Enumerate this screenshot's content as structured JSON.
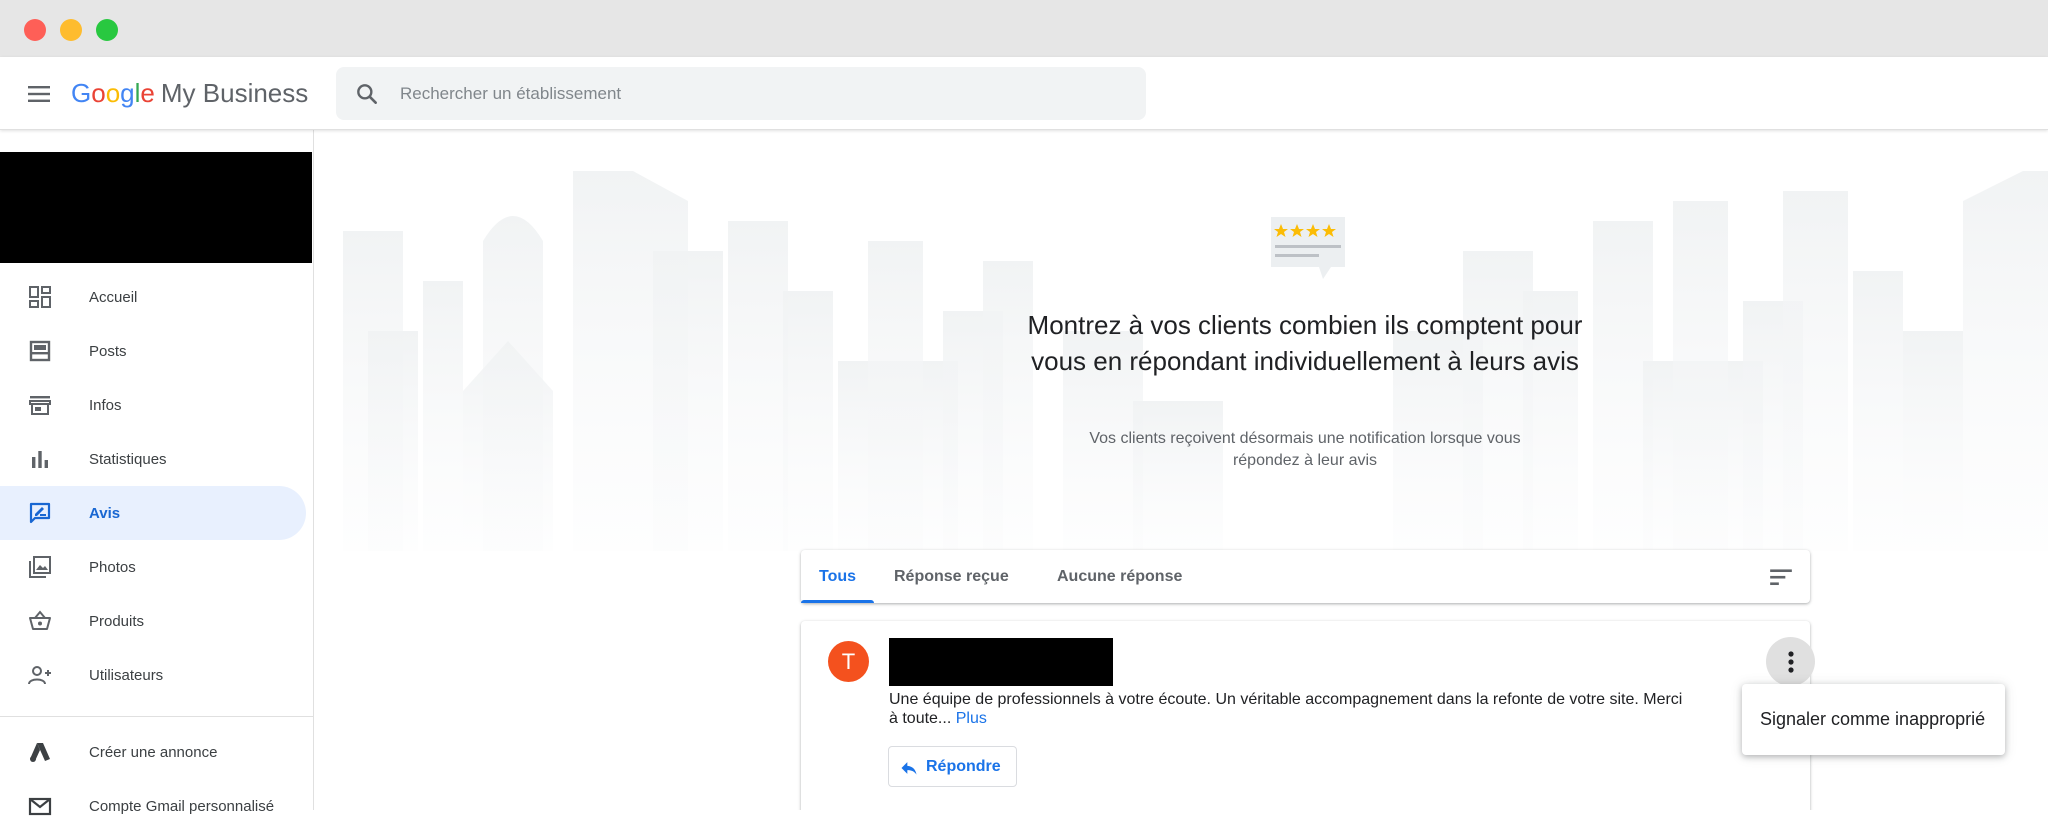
{
  "header": {
    "logo": {
      "g1": "G",
      "o1": "o",
      "o2": "o",
      "g2": "g",
      "l": "l",
      "e": "e",
      "product": "My Business"
    },
    "search": {
      "placeholder": "Rechercher un établissement",
      "value": ""
    }
  },
  "sidebar": {
    "items": [
      {
        "label": "Accueil",
        "icon": "dashboard-icon",
        "active": false
      },
      {
        "label": "Posts",
        "icon": "posts-icon",
        "active": false
      },
      {
        "label": "Infos",
        "icon": "storefront-icon",
        "active": false
      },
      {
        "label": "Statistiques",
        "icon": "bar-chart-icon",
        "active": false
      },
      {
        "label": "Avis",
        "icon": "rate-review-icon",
        "active": true
      },
      {
        "label": "Photos",
        "icon": "photo-library-icon",
        "active": false
      },
      {
        "label": "Produits",
        "icon": "shopping-basket-icon",
        "active": false
      },
      {
        "label": "Utilisateurs",
        "icon": "person-add-icon",
        "active": false
      }
    ],
    "extra_items": [
      {
        "label": "Créer une annonce",
        "icon": "google-ads-icon"
      },
      {
        "label": "Compte Gmail personnalisé",
        "icon": "gmail-icon"
      }
    ]
  },
  "hero": {
    "title": "Montrez à vos clients combien ils comptent pour vous en répondant individuellement à leurs avis",
    "subtitle": "Vos clients reçoivent désormais une notification lorsque vous répondez à leur avis"
  },
  "tabs": [
    {
      "label": "Tous",
      "active": true
    },
    {
      "label": "Réponse reçue",
      "active": false
    },
    {
      "label": "Aucune réponse",
      "active": false
    }
  ],
  "review": {
    "avatar_letter": "T",
    "text": "Une équipe de professionnels à votre écoute. Un véritable accompagnement dans la refonte de votre site. Merci à toute...",
    "more_label": "Plus",
    "reply_label": "Répondre"
  },
  "context_menu": {
    "items": [
      {
        "label": "Signaler comme inapproprié"
      }
    ]
  },
  "colors": {
    "accent": "#1a73e8",
    "active_bg": "#e8f0fe",
    "avatar": "#f4511e",
    "star": "#fbbc05"
  }
}
